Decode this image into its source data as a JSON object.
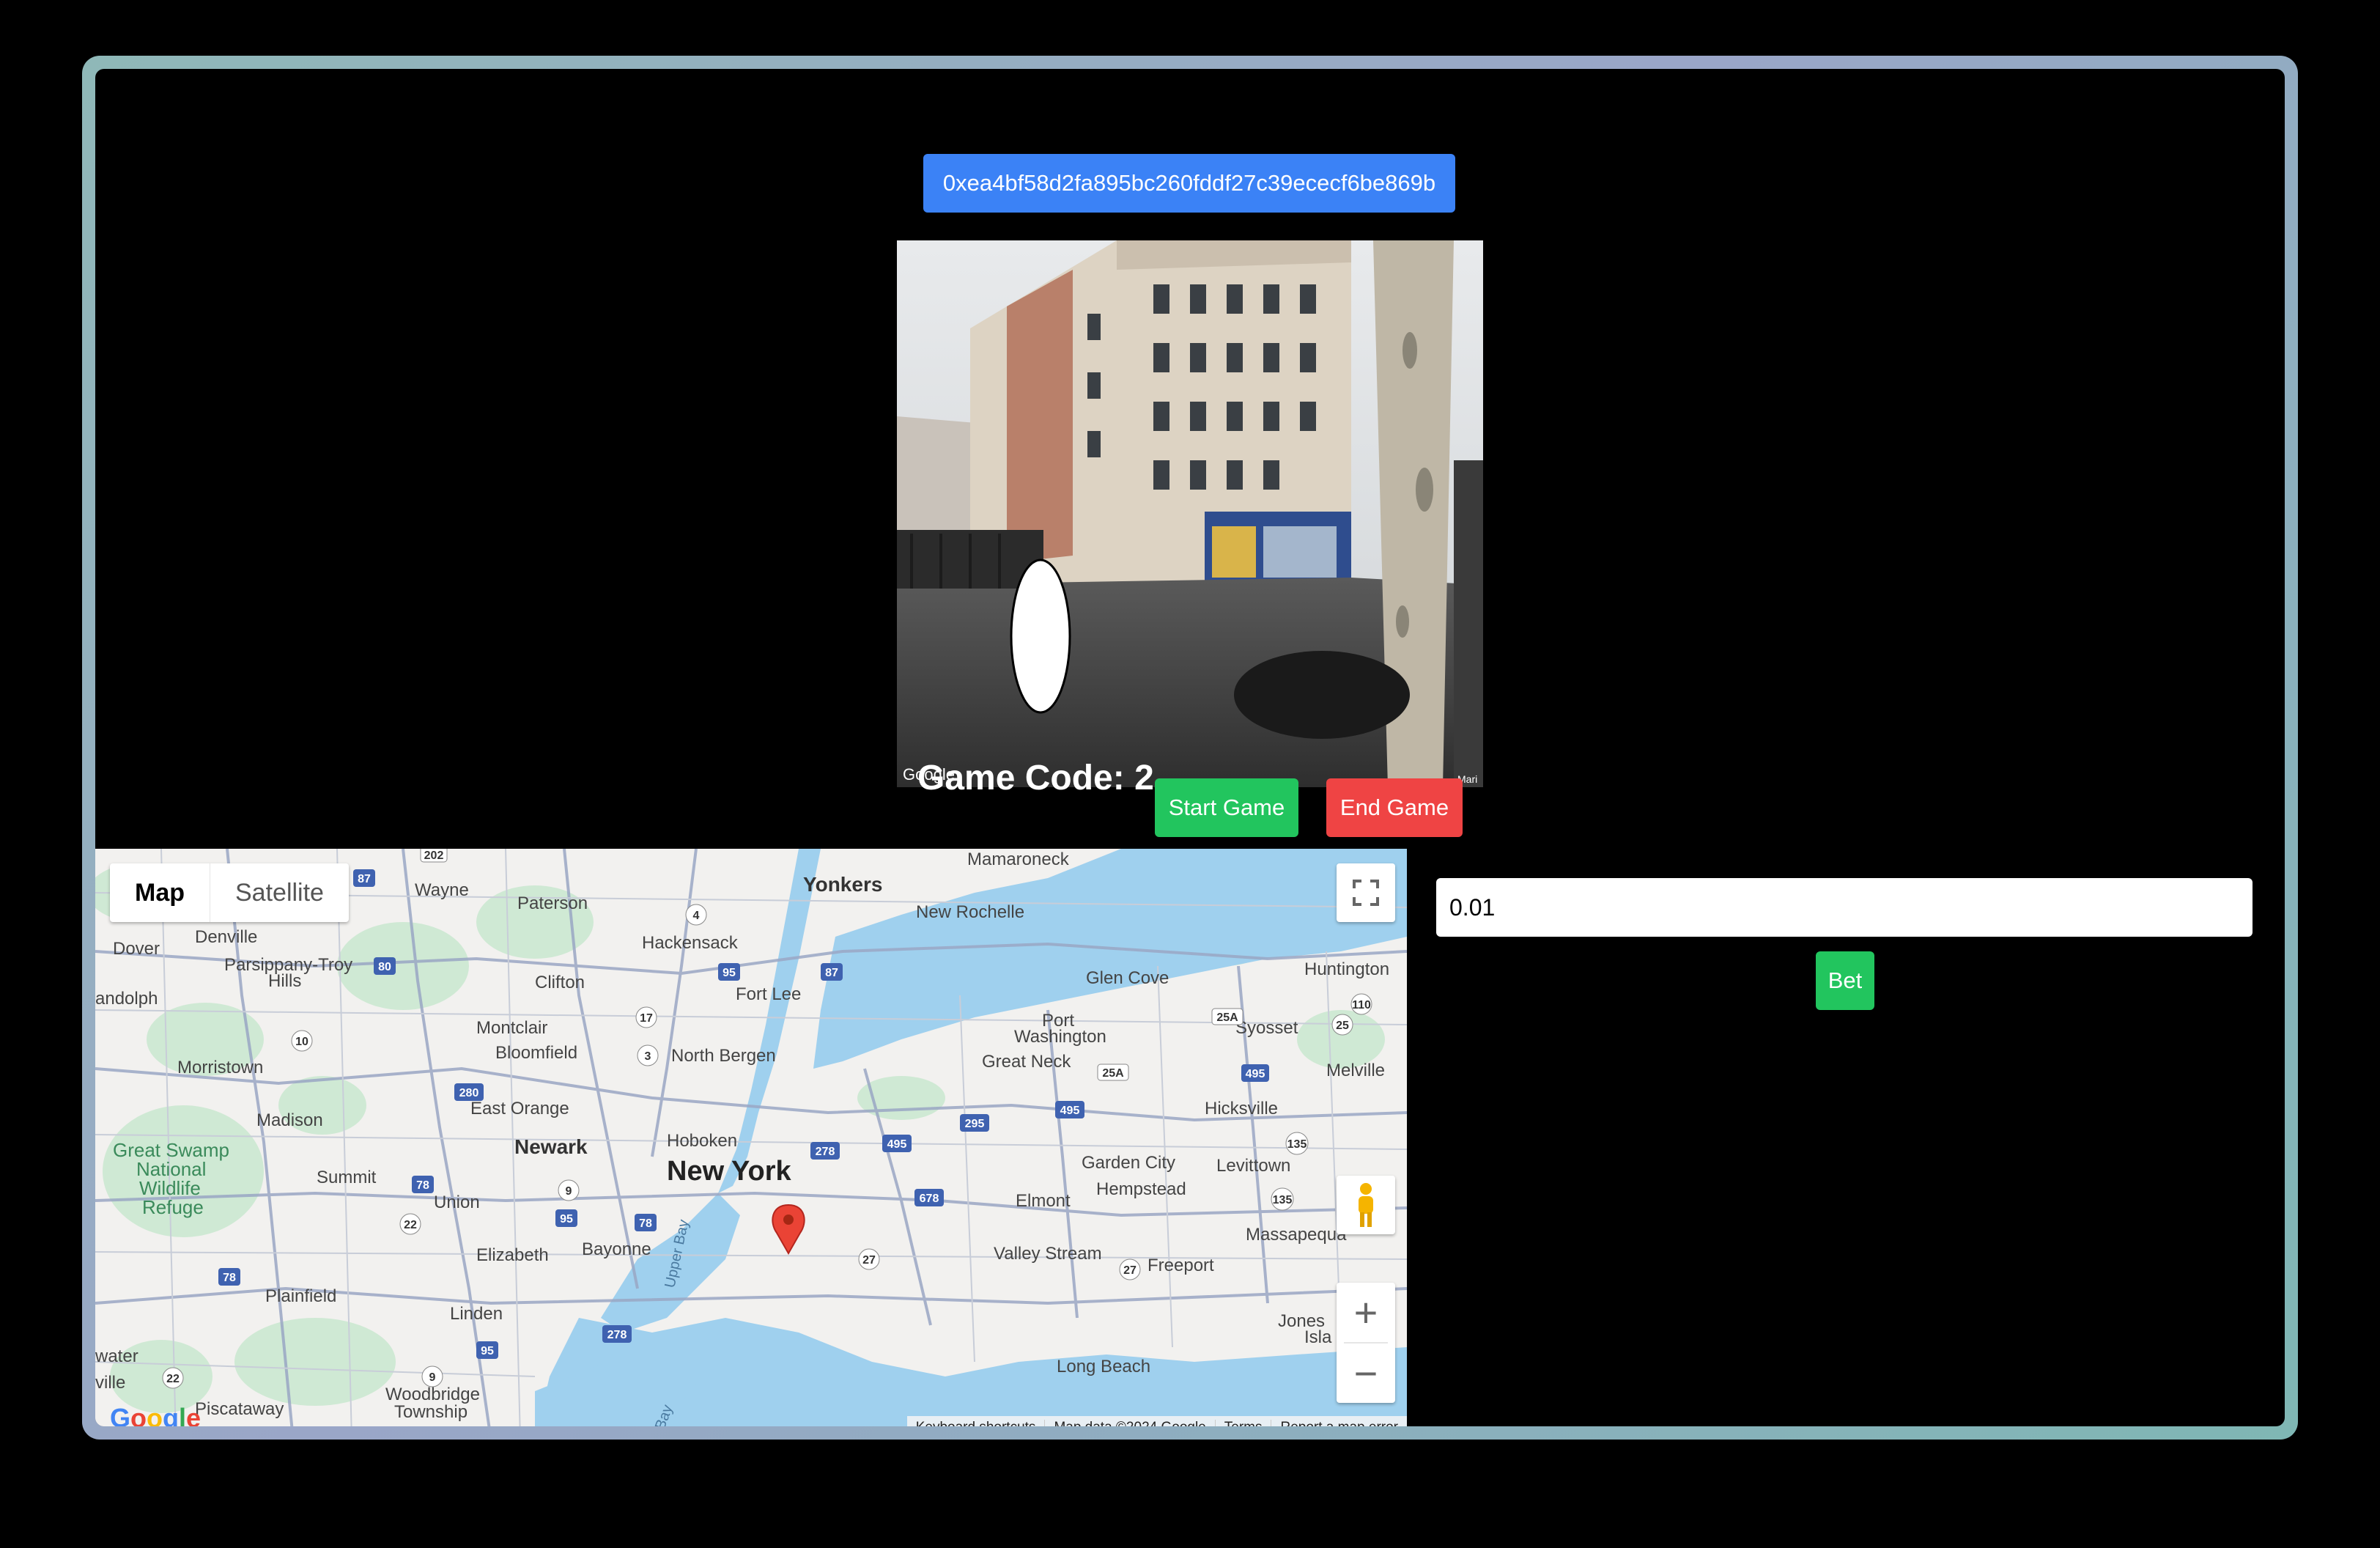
{
  "header": {
    "wallet_address": "0xea4bf58d2fa895bc260fddf27c39ececf6be869b"
  },
  "game": {
    "code_label": "Game Code: 2",
    "start_label": "Start Game",
    "end_label": "End Game"
  },
  "streetview": {
    "google_mark": "Google",
    "corner_text": "Mari"
  },
  "map": {
    "type_options": [
      "Map",
      "Satellite"
    ],
    "selected_type": "Map",
    "labels": {
      "yonkers": "Yonkers",
      "mamaroneck": "Mamaroneck",
      "new_rochelle": "New Rochelle",
      "paterson": "Paterson",
      "wayne": "Wayne",
      "denville": "Denville",
      "dover": "Dover",
      "parsippany": "Parsippany-Troy",
      "hills": "Hills",
      "randolph": "andolph",
      "hackensack": "Hackensack",
      "clifton": "Clifton",
      "fort_lee": "Fort Lee",
      "glen_cove": "Glen Cove",
      "huntington": "Huntington",
      "port": "Port",
      "washington": "Washington",
      "syosset": "Syosset",
      "montclair": "Montclair",
      "bloomfield": "Bloomfield",
      "north_bergen": "North Bergen",
      "great_neck": "Great Neck",
      "melville": "Melville",
      "morristown": "Morristown",
      "east_orange": "East Orange",
      "madison": "Madison",
      "hicksville": "Hicksville",
      "newark": "Newark",
      "hoboken": "Hoboken",
      "great_swamp": "Great Swamp",
      "national": "National",
      "wildlife": "Wildlife",
      "refuge": "Refuge",
      "garden_city": "Garden City",
      "levittown": "Levittown",
      "new_york": "New York",
      "summit": "Summit",
      "hempstead": "Hempstead",
      "union": "Union",
      "elmont": "Elmont",
      "massapequa": "Massapequa",
      "elizabeth": "Elizabeth",
      "bayonne": "Bayonne",
      "valley_stream": "Valley Stream",
      "freeport": "Freeport",
      "upper_bay": "Upper Bay",
      "plainfield": "Plainfield",
      "linden": "Linden",
      "jones": "Jones",
      "isla": "Isla",
      "water": "water",
      "ville": "ville",
      "long_beach": "Long Beach",
      "woodbridge": "Woodbridge",
      "township": "Township",
      "piscataway": "Piscataway",
      "bay": "Bay"
    },
    "shields": [
      "202",
      "87",
      "80",
      "4",
      "95",
      "87",
      "17",
      "10",
      "3",
      "280",
      "25A",
      "110",
      "25",
      "495",
      "278",
      "495",
      "295",
      "495",
      "135",
      "78",
      "9",
      "22",
      "95",
      "78",
      "678",
      "135",
      "27",
      "27",
      "78",
      "278",
      "95",
      "22",
      "9",
      "25A"
    ],
    "attribution": [
      "Keyboard shortcuts",
      "Map data ©2024 Google",
      "Terms",
      "Report a map error"
    ],
    "google_logo": "Google"
  },
  "bet": {
    "amount_value": "0.01",
    "bet_label": "Bet"
  },
  "colors": {
    "wallet": "#3b82f6",
    "start": "#22c55e",
    "end": "#ef4444",
    "bet": "#22c55e",
    "pin": "#ea4335"
  }
}
